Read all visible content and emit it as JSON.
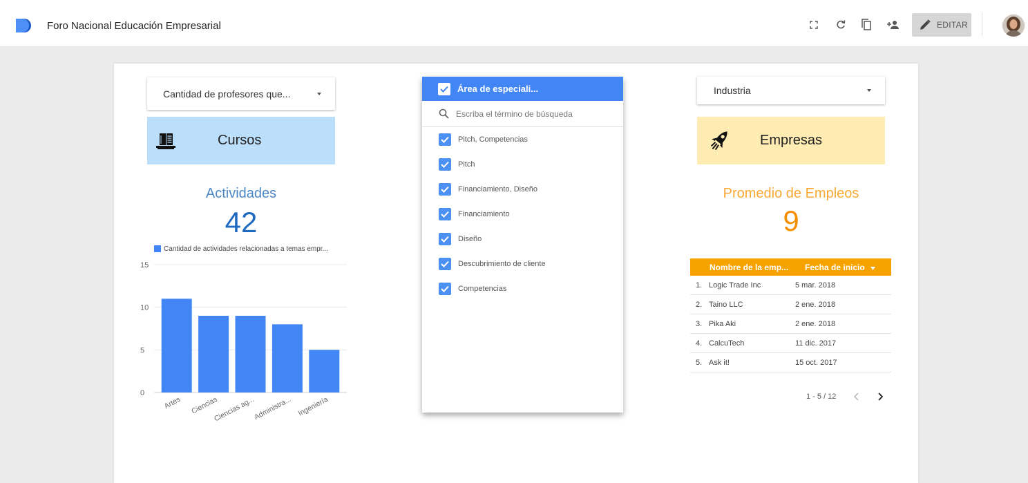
{
  "header": {
    "title": "Foro Nacional Educación Empresarial",
    "edit_label": "EDITAR",
    "icons": [
      "fullscreen-icon",
      "refresh-icon",
      "copy-icon",
      "share-icon",
      "pencil-icon",
      "avatar"
    ]
  },
  "left": {
    "dropdown_label": "Cantidad de profesores que...",
    "banner_text": "Cursos",
    "banner_color": "#bbdefb",
    "kpi_label": "Actividades",
    "kpi_value": "42",
    "kpi_color": "#4b87c5",
    "kpi_value_color": "#1f6ac1"
  },
  "chart_data": {
    "type": "bar",
    "categories": [
      "Artes",
      "Ciencias",
      "Ciencias ag...",
      "Administra...",
      "Ingeniería"
    ],
    "series": [
      {
        "name": "Cantidad de actividades relacionadas a temas empr...",
        "values": [
          11,
          9,
          9,
          8,
          5
        ]
      }
    ],
    "yticks": [
      "0",
      "5",
      "10",
      "15"
    ],
    "ylim": [
      0,
      15
    ],
    "color": "#4285f4",
    "legend": "top-left",
    "grid": true
  },
  "filter": {
    "header_label": "Área de especiali...",
    "search_placeholder": "Escriba el término de búsqueda",
    "options": [
      {
        "label": "Pitch, Competencias"
      },
      {
        "label": "Pitch"
      },
      {
        "label": "Financiamiento, Diseño"
      },
      {
        "label": "Financiamiento"
      },
      {
        "label": "Diseño"
      },
      {
        "label": "Descubrimiento de cliente"
      },
      {
        "label": "Competencias"
      }
    ]
  },
  "right": {
    "dropdown_label": "Industria",
    "banner_text": "Empresas",
    "banner_color": "#ffecb3",
    "kpi_label": "Promedio de Empleos",
    "kpi_value": "9",
    "kpi_color": "#f9a832",
    "kpi_value_color": "#f58f00"
  },
  "table": {
    "headers": [
      "Nombre de la emp...",
      "Fecha de inicio"
    ],
    "header_color": "#f6a300",
    "rows": [
      {
        "num": "1.",
        "name": "Logic Trade Inc",
        "date": "5 mar. 2018"
      },
      {
        "num": "2.",
        "name": "Taino LLC",
        "date": "2 ene. 2018"
      },
      {
        "num": "3.",
        "name": "Pika Aki",
        "date": "2 ene. 2018"
      },
      {
        "num": "4.",
        "name": "CalcuTech",
        "date": "11 dic. 2017"
      },
      {
        "num": "5.",
        "name": "Ask it!",
        "date": "15 oct. 2017"
      }
    ],
    "pagination": "1 - 5 / 12"
  }
}
